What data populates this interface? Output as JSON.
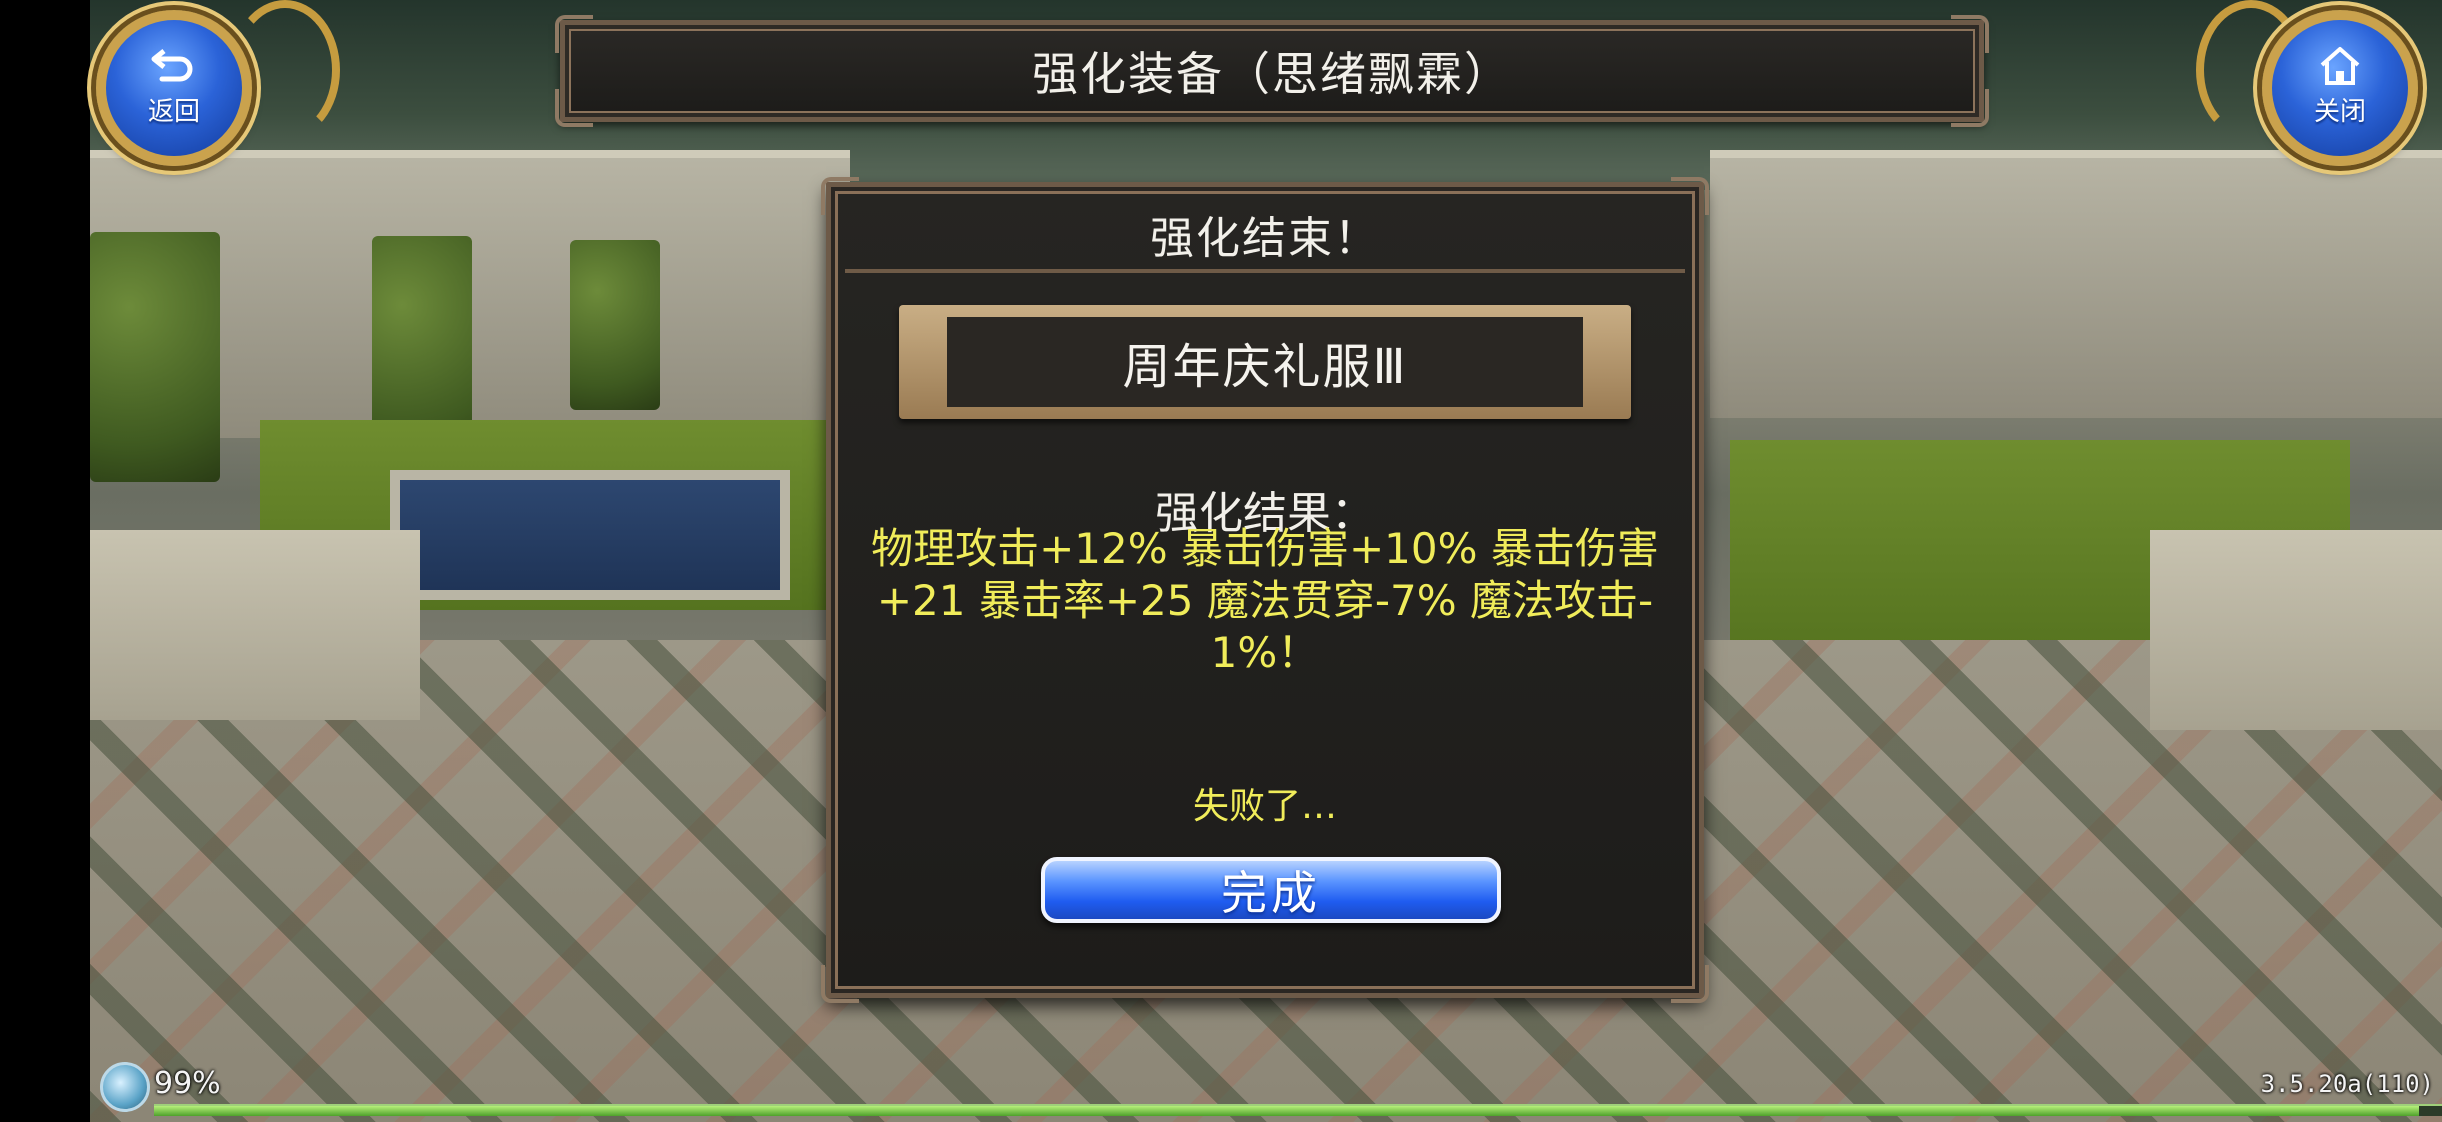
{
  "window": {
    "title": "强化装备（思绪飘霖）"
  },
  "nav": {
    "back_label": "返回",
    "back_icon": "return-arrow-icon",
    "close_label": "关闭",
    "close_icon": "home-icon"
  },
  "dialog": {
    "header": "强化结束！",
    "item_name": "周年庆礼服Ⅲ",
    "result_label": "强化结果：",
    "result_text": "物理攻击+12% 暴击伤害+10% 暴击伤害+21 暴击率+25 魔法贯穿-7% 魔法攻击-1%！",
    "status_text": "失败了…",
    "done_label": "完成"
  },
  "status_bar": {
    "battery": "99%",
    "battery_fraction": 0.99,
    "version": "3.5.20a(110)"
  },
  "colors": {
    "result_yellow": "#f0ec5a",
    "button_blue": "#1f5cf0",
    "frame_bronze": "#8a7058"
  }
}
